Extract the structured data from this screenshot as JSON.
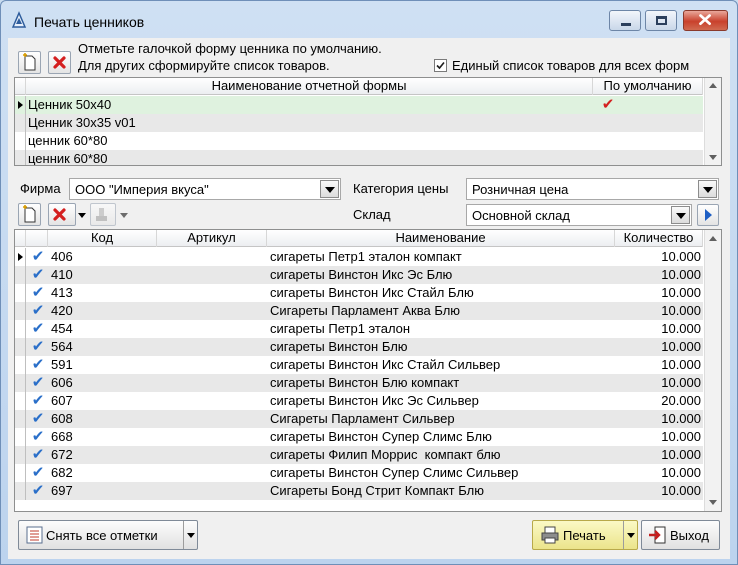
{
  "window": {
    "title": "Печать ценников"
  },
  "forms_toolbar": {
    "hint_line1": "Отметьте галочкой форму ценника по умолчанию.",
    "hint_line2": "Для других сформируйте список товаров.",
    "single_list_label": "Единый список товаров для всех форм",
    "single_list_checked": true
  },
  "forms_grid": {
    "col_name": "Наименование отчетной формы",
    "col_default": "По умолчанию",
    "rows": [
      {
        "name": "Ценник 50x40",
        "default": true
      },
      {
        "name": "Ценник 30x35 v01",
        "default": false
      },
      {
        "name": "ценник 60*80",
        "default": false
      },
      {
        "name": "ценник 60*80",
        "default": false
      }
    ]
  },
  "filters": {
    "firm_label": "Фирма",
    "firm_value": "ООО \"Империя вкуса\"",
    "price_cat_label": "Категория цены",
    "price_cat_value": "Розничная цена",
    "warehouse_label": "Склад",
    "warehouse_value": "Основной склад"
  },
  "items_grid": {
    "col_code": "Код",
    "col_article": "Артикул",
    "col_name": "Наименование",
    "col_qty": "Количество",
    "rows": [
      {
        "code": "406",
        "article": "",
        "name": "сигареты Петр1 эталон компакт",
        "qty": "10.000"
      },
      {
        "code": "410",
        "article": "",
        "name": "сигареты Винстон Икс Эс Блю",
        "qty": "10.000"
      },
      {
        "code": "413",
        "article": "",
        "name": "сигареты Винстон Икс Стайл Блю",
        "qty": "10.000"
      },
      {
        "code": "420",
        "article": "",
        "name": "Сигареты Парламент Аква Блю",
        "qty": "10.000"
      },
      {
        "code": "454",
        "article": "",
        "name": "сигареты Петр1 эталон",
        "qty": "10.000"
      },
      {
        "code": "564",
        "article": "",
        "name": "сигареты Винстон Блю",
        "qty": "10.000"
      },
      {
        "code": "591",
        "article": "",
        "name": "сигареты Винстон Икс Стайл Сильвер",
        "qty": "10.000"
      },
      {
        "code": "606",
        "article": "",
        "name": "сигареты Винстон Блю компакт",
        "qty": "10.000"
      },
      {
        "code": "607",
        "article": "",
        "name": "сигареты Винстон Икс Эс Сильвер",
        "qty": "20.000"
      },
      {
        "code": "608",
        "article": "",
        "name": "Сигареты Парламент Сильвер",
        "qty": "10.000"
      },
      {
        "code": "668",
        "article": "",
        "name": "сигареты Винстон Супер Слимс Блю",
        "qty": "10.000"
      },
      {
        "code": "672",
        "article": "",
        "name": "сигареты Филип Моррис  компакт блю",
        "qty": "10.000"
      },
      {
        "code": "682",
        "article": "",
        "name": "сигареты Винстон Супер Слимс Сильвер",
        "qty": "10.000"
      },
      {
        "code": "697",
        "article": "",
        "name": "Сигареты Бонд Стрит Компакт Блю",
        "qty": "10.000"
      }
    ]
  },
  "footer": {
    "clear_label": "Снять все отметки",
    "print_label": "Печать",
    "exit_label": "Выход"
  },
  "icons": {
    "check_glyph": "✔"
  },
  "colors": {
    "selected_row": "#dff2df",
    "alt_row": "#e8e8e8",
    "check_blue": "#2a6fc9",
    "check_red": "#d42020",
    "print_highlight": "#f6f3a3"
  }
}
